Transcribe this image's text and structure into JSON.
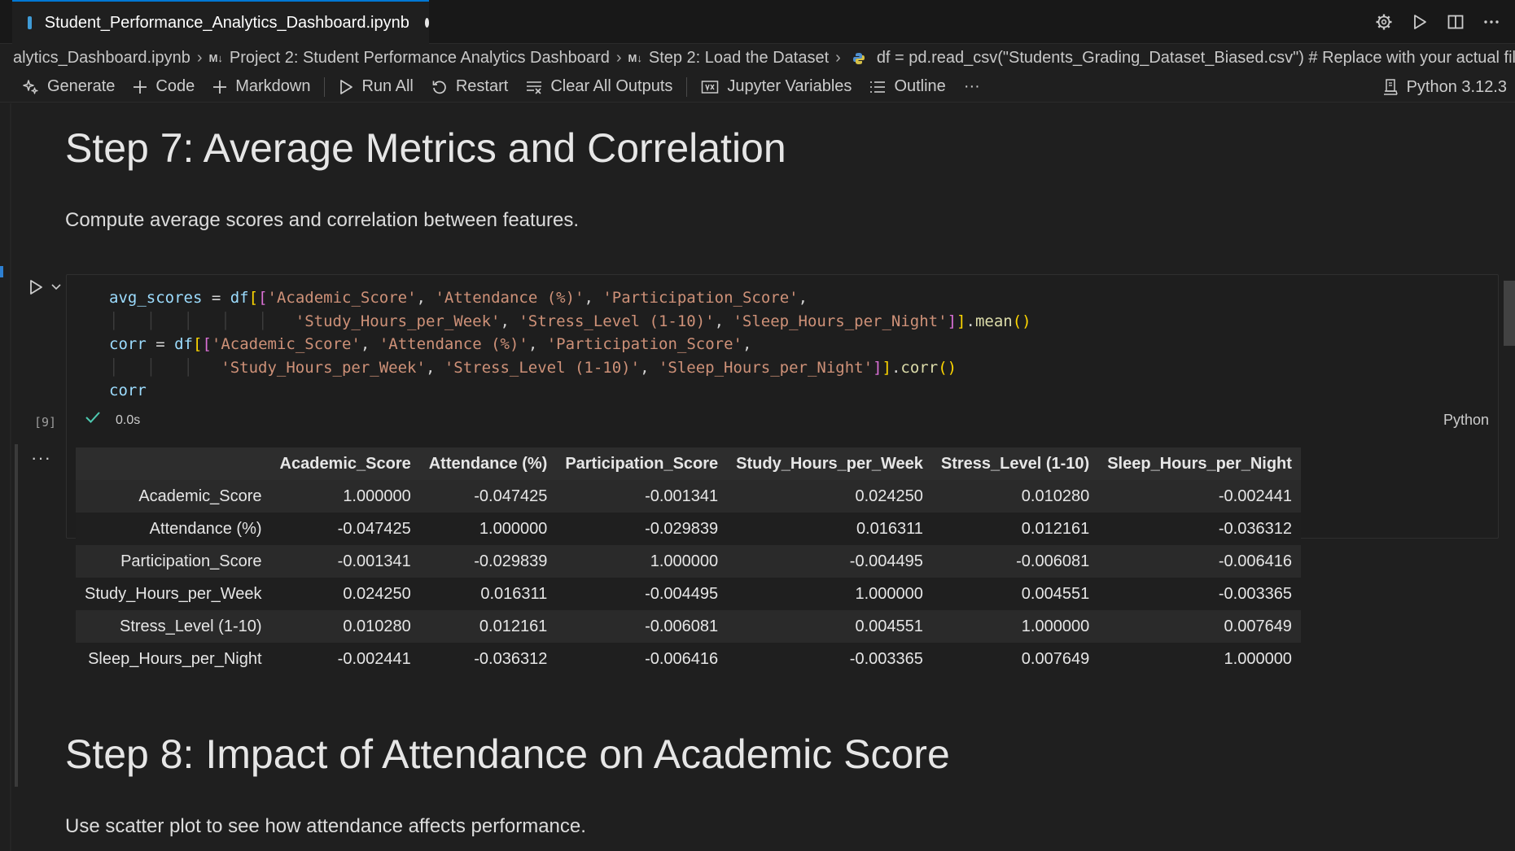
{
  "tab": {
    "title": "Student_Performance_Analytics_Dashboard.ipynb"
  },
  "breadcrumb": {
    "file": "alytics_Dashboard.ipynb",
    "md_badge": "M↓",
    "section": "Project 2: Student Performance Analytics Dashboard",
    "step": "Step 2: Load the Dataset",
    "code": "df = pd.read_csv(\"Students_Grading_Dataset_Biased.csv\")  # Replace with your actual filename"
  },
  "toolbar": {
    "generate": "Generate",
    "code": "Code",
    "markdown": "Markdown",
    "run_all": "Run All",
    "restart": "Restart",
    "clear_outputs": "Clear All Outputs",
    "variables": "Jupyter Variables",
    "outline": "Outline",
    "more": "···",
    "kernel": "Python 3.12.3"
  },
  "step7": {
    "heading": "Step 7: Average Metrics and Correlation",
    "description": "Compute average scores and correlation between features."
  },
  "code_cell": {
    "exec_count": "[9]",
    "duration": "0.0s",
    "language": "Python"
  },
  "output": {
    "more": "···",
    "columns": [
      "",
      "Academic_Score",
      "Attendance (%)",
      "Participation_Score",
      "Study_Hours_per_Week",
      "Stress_Level (1-10)",
      "Sleep_Hours_per_Night"
    ],
    "rows": [
      [
        "Academic_Score",
        "1.000000",
        "-0.047425",
        "-0.001341",
        "0.024250",
        "0.010280",
        "-0.002441"
      ],
      [
        "Attendance (%)",
        "-0.047425",
        "1.000000",
        "-0.029839",
        "0.016311",
        "0.012161",
        "-0.036312"
      ],
      [
        "Participation_Score",
        "-0.001341",
        "-0.029839",
        "1.000000",
        "-0.004495",
        "-0.006081",
        "-0.006416"
      ],
      [
        "Study_Hours_per_Week",
        "0.024250",
        "0.016311",
        "-0.004495",
        "1.000000",
        "0.004551",
        "-0.003365"
      ],
      [
        "Stress_Level (1-10)",
        "0.010280",
        "0.012161",
        "-0.006081",
        "0.004551",
        "1.000000",
        "0.007649"
      ],
      [
        "Sleep_Hours_per_Night",
        "-0.002441",
        "-0.036312",
        "-0.006416",
        "-0.003365",
        "0.007649",
        "1.000000"
      ]
    ]
  },
  "step8": {
    "heading": "Step 8: Impact of Attendance on Academic Score",
    "description": "Use scatter plot to see how attendance affects performance."
  }
}
